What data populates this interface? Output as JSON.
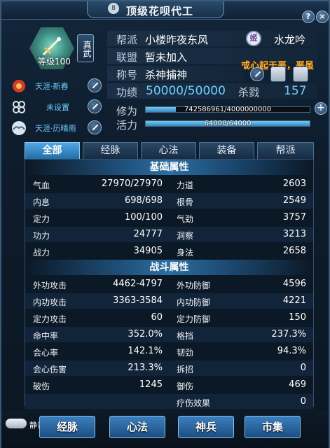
{
  "window": {
    "title": "顶级花呗代工",
    "title_badge": "8",
    "help": "?",
    "close": "×"
  },
  "profile": {
    "level": "等级100",
    "sect_badge": "真武",
    "side_items": [
      {
        "label": "天涯·新春",
        "icon": "lantern-icon"
      },
      {
        "label": "未设置",
        "icon": "clover-icon"
      },
      {
        "label": "天涯·历晴雨",
        "icon": "cloud-icon"
      }
    ]
  },
  "info": {
    "guild_label": "帮派",
    "guild_value": "小楼昨夜东风",
    "alliance_label": "联盟",
    "alliance_value": "暂未加入",
    "title_label": "称号",
    "title_value": "杀神捕神",
    "merit_label": "功绩",
    "merit_value": "50000/50000",
    "kill_label": "杀戮",
    "kill_value": "157",
    "server_icon": "姬",
    "server_name": "水龙吟",
    "banner": "或心起于恶，恶虽"
  },
  "bars": {
    "cultivation_label": "修为",
    "cultivation_text": "742586961/4000000000",
    "cultivation_fraction": 0.1856,
    "vitality_label": "活力",
    "vitality_text": "64000/64000",
    "vitality_fraction": 1.0,
    "plus": "+"
  },
  "tabs": [
    "全部",
    "经脉",
    "心法",
    "装备",
    "帮派"
  ],
  "basic": {
    "heading": "基础属性",
    "rows": [
      [
        "气血",
        "27970/27970",
        "力道",
        "2603"
      ],
      [
        "内息",
        "698/698",
        "根骨",
        "2549"
      ],
      [
        "定力",
        "100/100",
        "气劲",
        "3757"
      ],
      [
        "功力",
        "24777",
        "洞察",
        "3213"
      ],
      [
        "战力",
        "34905",
        "身法",
        "2658"
      ]
    ]
  },
  "battle": {
    "heading": "战斗属性",
    "rows": [
      [
        "外功攻击",
        "4462-4797",
        "外功防御",
        "4596"
      ],
      [
        "内功攻击",
        "3363-3584",
        "内功防御",
        "4221"
      ],
      [
        "定力攻击",
        "60",
        "定力防御",
        "150"
      ],
      [
        "命中率",
        "352.0%",
        "格挡",
        "237.3%"
      ],
      [
        "会心率",
        "142.1%",
        "韧劲",
        "94.3%"
      ],
      [
        "会心伤害",
        "213.3%",
        "拆招",
        "0"
      ],
      [
        "破伤",
        "1245",
        "御伤",
        "469"
      ],
      [
        "",
        "",
        "疗伤效果",
        "0"
      ]
    ]
  },
  "bottom": {
    "mute_label": "静音",
    "buttons": [
      "经脉",
      "心法",
      "神兵",
      "市集"
    ]
  }
}
